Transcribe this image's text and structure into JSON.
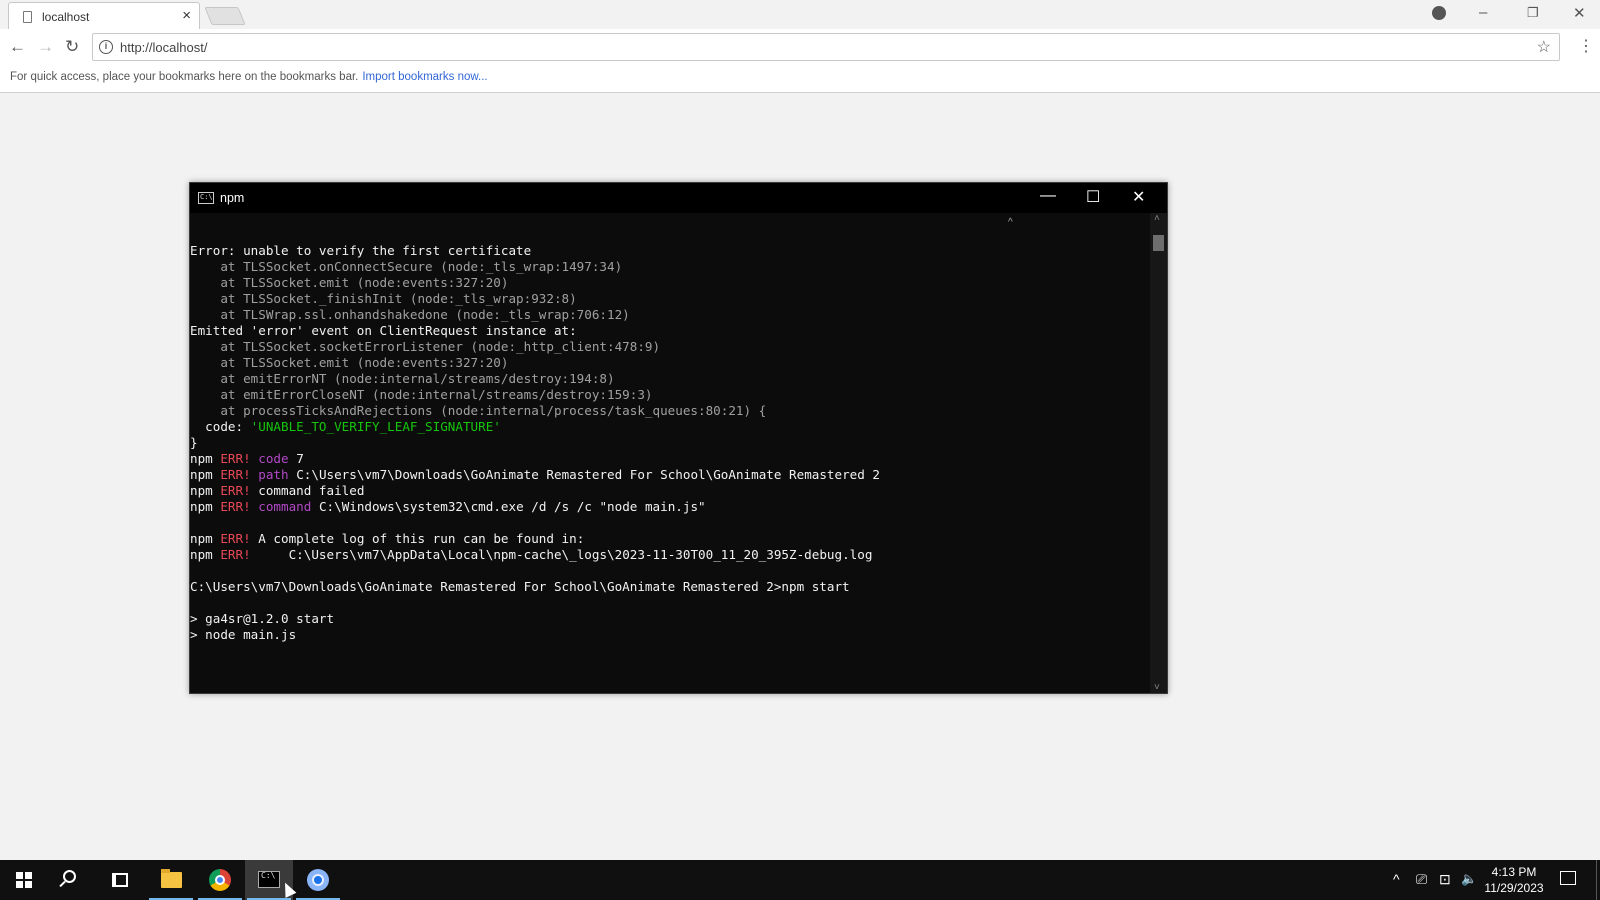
{
  "browser": {
    "tab_title": "localhost",
    "tab_close": "×",
    "url": "http://localhost/",
    "info_icon": "i",
    "star_icon": "☆",
    "menu_icon": "⋮",
    "nav": {
      "back": "←",
      "forward": "→",
      "reload": "↻"
    },
    "window_controls": {
      "minimize": "–",
      "restore": "❐",
      "close": "✕"
    },
    "bookmarks_bar": {
      "message": "For quick access, place your bookmarks here on the bookmarks bar.",
      "link": "Import bookmarks now..."
    }
  },
  "console": {
    "title": "npm",
    "icon_text": "C:\\",
    "controls": {
      "minimize": "—",
      "maximize": "☐",
      "close": "✕"
    },
    "scroll": {
      "up": "˄",
      "down": "˅",
      "caret": "^"
    },
    "lines": {
      "l01": "Error: unable to verify the first certificate",
      "l02": "    at TLSSocket.onConnectSecure (node:_tls_wrap:1497:34)",
      "l03": "    at TLSSocket.emit (node:events:327:20)",
      "l04": "    at TLSSocket._finishInit (node:_tls_wrap:932:8)",
      "l05": "    at TLSWrap.ssl.onhandshakedone (node:_tls_wrap:706:12)",
      "l06": "Emitted 'error' event on ClientRequest instance at:",
      "l07": "    at TLSSocket.socketErrorListener (node:_http_client:478:9)",
      "l08": "    at TLSSocket.emit (node:events:327:20)",
      "l09": "    at emitErrorNT (node:internal/streams/destroy:194:8)",
      "l10": "    at emitErrorCloseNT (node:internal/streams/destroy:159:3)",
      "l11": "    at processTicksAndRejections (node:internal/process/task_queues:80:21) {",
      "l12_key": "  code: ",
      "l12_val": "'UNABLE_TO_VERIFY_LEAF_SIGNATURE'",
      "l13": "}",
      "npm": "npm ",
      "err": "ERR!",
      "l14_key": " code",
      "l14_val": " 7",
      "l15_key": " path",
      "l15_val": " C:\\Users\\vm7\\Downloads\\GoAnimate Remastered For School\\GoAnimate Remastered 2",
      "l16_val": " command failed",
      "l17_key": " command",
      "l17_val": " C:\\Windows\\system32\\cmd.exe /d /s /c \"node main.js\"",
      "l19_val": " A complete log of this run can be found in:",
      "l20_val": "     C:\\Users\\vm7\\AppData\\Local\\npm-cache\\_logs\\2023-11-30T00_11_20_395Z-debug.log",
      "l22": "C:\\Users\\vm7\\Downloads\\GoAnimate Remastered For School\\GoAnimate Remastered 2>npm start",
      "l24": "> ga4sr@1.2.0 start",
      "l25": "> node main.js"
    }
  },
  "taskbar": {
    "clock_time": "4:13 PM",
    "clock_date": "11/29/2023",
    "tray": {
      "chevron": "^",
      "meet": "⎚",
      "network": "⊡",
      "volume": "🔈"
    }
  }
}
